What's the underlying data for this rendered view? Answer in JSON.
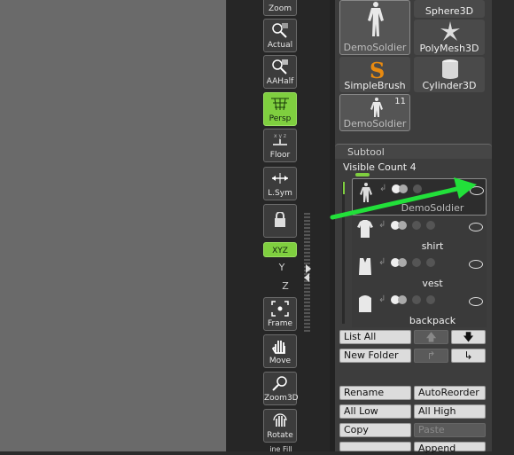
{
  "shelf": {
    "tools": [
      {
        "id": "zoom",
        "label": "Zoom",
        "icon": "zoom-icon"
      },
      {
        "id": "actual",
        "label": "Actual",
        "icon": "actual-icon"
      },
      {
        "id": "aahalf",
        "label": "AAHalf",
        "icon": "aahalf-icon"
      },
      {
        "id": "persp",
        "label": "Persp",
        "icon": "persp-icon",
        "active": true
      },
      {
        "id": "floor",
        "label": "Floor",
        "icon": "floor-icon"
      },
      {
        "id": "lsym",
        "label": "L.Sym",
        "icon": "lsym-icon"
      },
      {
        "id": "lock",
        "label": "",
        "icon": "lock-icon"
      },
      {
        "id": "xyz",
        "label": "XYZ",
        "icon": "rotate-xyz-icon",
        "active": true
      },
      {
        "id": "frame",
        "label": "Frame",
        "icon": "frame-icon"
      },
      {
        "id": "move",
        "label": "Move",
        "icon": "move-hand-icon"
      },
      {
        "id": "zoom3d",
        "label": "Zoom3D",
        "icon": "zoom3d-icon"
      },
      {
        "id": "rotate",
        "label": "Rotate",
        "icon": "rotate-icon"
      }
    ],
    "axis_y": "Y",
    "axis_z": "Z",
    "bottom_cut_label": "ine Fill"
  },
  "tool_thumbs": [
    {
      "label": "DemoSoldier",
      "selected": true
    },
    {
      "label": "Sphere3D"
    },
    {
      "label": "PolyMesh3D"
    },
    {
      "label": "SimpleBrush"
    },
    {
      "label": "Cylinder3D"
    },
    {
      "label": "DemoSoldier",
      "badge": "11",
      "selected": true
    }
  ],
  "subtool": {
    "title": "Subtool",
    "visible_count": "Visible Count 4",
    "items": [
      {
        "name": "DemoSoldier",
        "selected": true
      },
      {
        "name": "shirt"
      },
      {
        "name": "vest"
      },
      {
        "name": "backpack"
      }
    ],
    "buttons": {
      "list_all": "List All",
      "new_folder": "New Folder",
      "rename": "Rename",
      "auto_reorder": "AutoReorder",
      "all_low": "All Low",
      "all_high": "All High",
      "copy": "Copy",
      "paste": "Paste",
      "append": "Append"
    }
  },
  "colors": {
    "accent": "#7fcf3f",
    "annotation_arrow": "#22e03a"
  }
}
